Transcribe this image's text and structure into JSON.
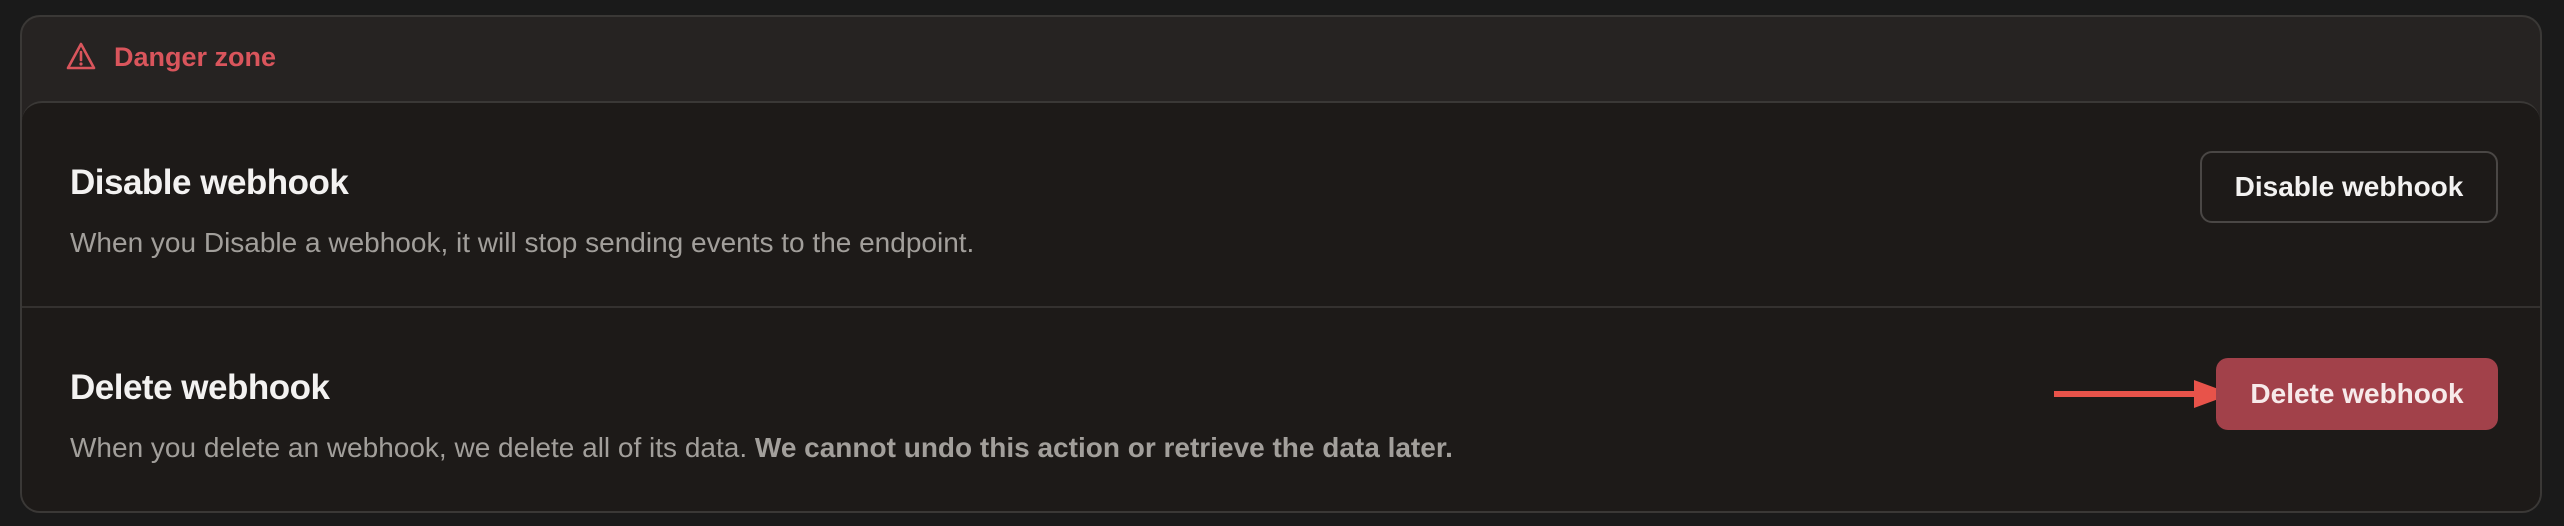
{
  "panel": {
    "title": "Danger zone",
    "icon": "warning-triangle-icon",
    "accent_color": "#d9555c"
  },
  "disable": {
    "title": "Disable webhook",
    "description": "When you Disable a webhook, it will stop sending events to the endpoint.",
    "button_label": "Disable webhook"
  },
  "delete": {
    "title": "Delete webhook",
    "description_plain": "When you delete an webhook, we delete all of its data. ",
    "description_bold": "We cannot undo this action or retrieve the data later.",
    "button_label": "Delete webhook",
    "button_color": "#a2414a",
    "arrow_color": "#e8534a"
  }
}
